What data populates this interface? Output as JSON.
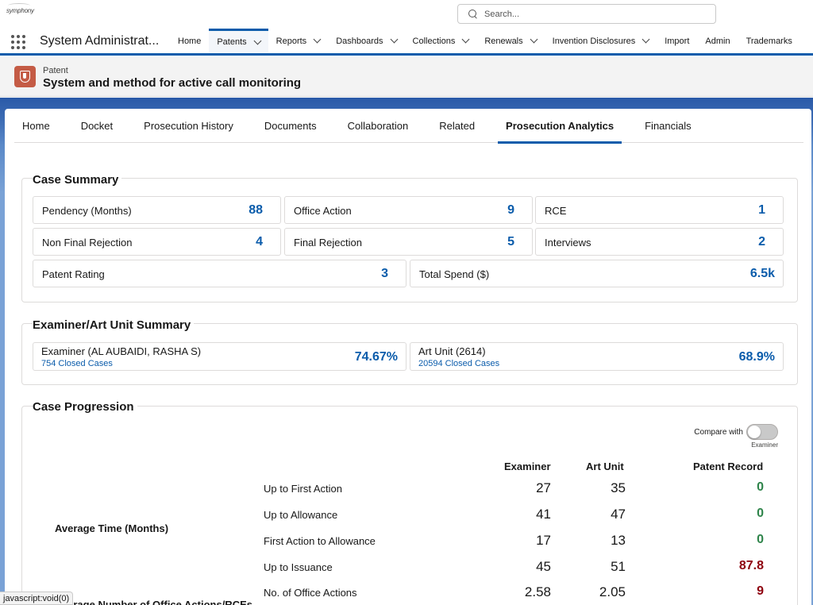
{
  "global": {
    "logo_text": "symphony",
    "search_placeholder": "Search..."
  },
  "nav": {
    "app_name": "System Administrat...",
    "items": [
      {
        "label": "Home",
        "dropdown": false,
        "active": false
      },
      {
        "label": "Patents",
        "dropdown": true,
        "active": true
      },
      {
        "label": "Reports",
        "dropdown": true,
        "active": false
      },
      {
        "label": "Dashboards",
        "dropdown": true,
        "active": false
      },
      {
        "label": "Collections",
        "dropdown": true,
        "active": false
      },
      {
        "label": "Renewals",
        "dropdown": true,
        "active": false
      },
      {
        "label": "Invention Disclosures",
        "dropdown": true,
        "active": false
      },
      {
        "label": "Import",
        "dropdown": false,
        "active": false
      },
      {
        "label": "Admin",
        "dropdown": false,
        "active": false
      },
      {
        "label": "Trademarks",
        "dropdown": false,
        "active": false
      }
    ]
  },
  "record": {
    "type_label": "Patent",
    "title": "System and method for active call monitoring",
    "icon": "shield-icon"
  },
  "tabs": [
    {
      "label": "Home",
      "active": false
    },
    {
      "label": "Docket",
      "active": false
    },
    {
      "label": "Prosecution History",
      "active": false
    },
    {
      "label": "Documents",
      "active": false
    },
    {
      "label": "Collaboration",
      "active": false
    },
    {
      "label": "Related",
      "active": false
    },
    {
      "label": "Prosecution Analytics",
      "active": true
    },
    {
      "label": "Financials",
      "active": false
    }
  ],
  "case_summary": {
    "title": "Case Summary",
    "tiles": {
      "pendency": {
        "label": "Pendency (Months)",
        "value": "88"
      },
      "office_action": {
        "label": "Office Action",
        "value": "9"
      },
      "rce": {
        "label": "RCE",
        "value": "1"
      },
      "non_final": {
        "label": "Non Final Rejection",
        "value": "4"
      },
      "final_rejection": {
        "label": "Final Rejection",
        "value": "5"
      },
      "interviews": {
        "label": "Interviews",
        "value": "2"
      },
      "patent_rating": {
        "label": "Patent Rating",
        "value": "3"
      },
      "total_spend": {
        "label": "Total Spend ($)",
        "value": "6.5k"
      }
    }
  },
  "examiner_summary": {
    "title": "Examiner/Art Unit Summary",
    "examiner": {
      "label": "Examiner (AL AUBAIDI, RASHA S)",
      "link": "754 Closed Cases",
      "pct": "74.67%"
    },
    "art_unit": {
      "label": "Art Unit (2614)",
      "link": "20594 Closed Cases",
      "pct": "68.9%"
    }
  },
  "case_progression": {
    "title": "Case Progression",
    "toggle": {
      "label": "Compare with",
      "sub": "Examiner",
      "on": false
    },
    "columns": {
      "examiner": "Examiner",
      "art_unit": "Art Unit",
      "patent_record": "Patent Record"
    },
    "group_avg_time": "Average Time (Months)",
    "group_avg_number": "Average Number of Office Actions/RCEs",
    "rows": [
      {
        "label": "Up to First Action",
        "examiner": "27",
        "art_unit": "35",
        "record": "0"
      },
      {
        "label": "Up to Allowance",
        "examiner": "41",
        "art_unit": "47",
        "record": "0"
      },
      {
        "label": "First Action to Allowance",
        "examiner": "17",
        "art_unit": "13",
        "record": "0"
      },
      {
        "label": "Up to Issuance",
        "examiner": "45",
        "art_unit": "51",
        "record": "87.8"
      },
      {
        "label": "No. of Office Actions",
        "examiner": "2.58",
        "art_unit": "2.05",
        "record": "9"
      }
    ],
    "record_colors": {
      "good": "#2e844a",
      "bad": "#8e030f"
    }
  },
  "status_bar": {
    "text": "javascript:void(0)"
  },
  "colors": {
    "accent": "#0b5cab",
    "record_icon": "#c45b45"
  }
}
